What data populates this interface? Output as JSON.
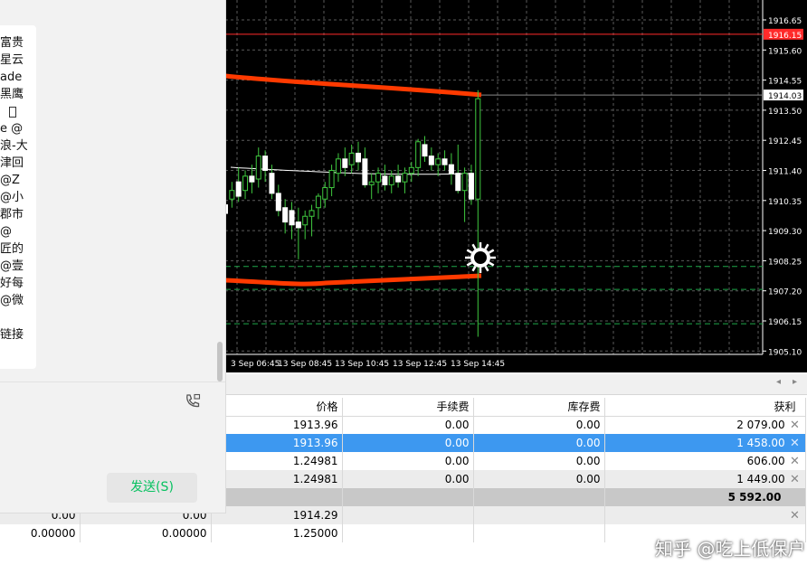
{
  "chart": {
    "price_labels": [
      "1916.65",
      "1915.60",
      "1914.55",
      "1913.50",
      "1912.45",
      "1911.40",
      "1910.35",
      "1909.30",
      "1908.25",
      "1907.20",
      "1906.15",
      "1905.10"
    ],
    "bid_tag": "1916.15",
    "ask_tag": "1914.03",
    "time_labels": [
      "3 Sep 06:45",
      "13 Sep 08:45",
      "13 Sep 10:45",
      "13 Sep 12:45",
      "13 Sep 14:45"
    ],
    "colors": {
      "background": "#000000",
      "grid": "#5a5a5a",
      "band": "#ff3a00",
      "bid_line": "#ff2a2a",
      "candle": "#ffffff",
      "stops": "#1fa84a"
    }
  },
  "terminal": {
    "columns": [
      "价格",
      "手续费",
      "库存费",
      "获利"
    ],
    "rows": [
      {
        "price": "1913.96",
        "commission": "0.00",
        "swap": "0.00",
        "profit": "2 079.00"
      },
      {
        "price": "1913.96",
        "commission": "0.00",
        "swap": "0.00",
        "profit": "1 458.00"
      },
      {
        "price": "1.24981",
        "commission": "0.00",
        "swap": "0.00",
        "profit": "606.00"
      },
      {
        "price": "1.24981",
        "commission": "0.00",
        "swap": "0.00",
        "profit": "1 449.00"
      }
    ],
    "total_profit": "5 592.00",
    "pending": [
      {
        "a": "0.00",
        "b": "0.00",
        "price": "1914.29"
      },
      {
        "a": "0.00000",
        "b": "0.00000",
        "price": "1.25000"
      }
    ],
    "close_glyph": "✕",
    "scroll_left": "◂",
    "scroll_right": "▸"
  },
  "chat": {
    "message_fragments": [
      "富贵",
      "星云",
      "ade",
      "黑鹰",
      "",
      "e @",
      "浪-大",
      "津回",
      " @Z",
      "@小",
      "郡市",
      "@",
      "匠的",
      "@壹",
      "好每",
      " @微",
      "",
      "链接"
    ],
    "send_label": "发送(S)"
  },
  "watermark": "知乎 @吃上低保户"
}
